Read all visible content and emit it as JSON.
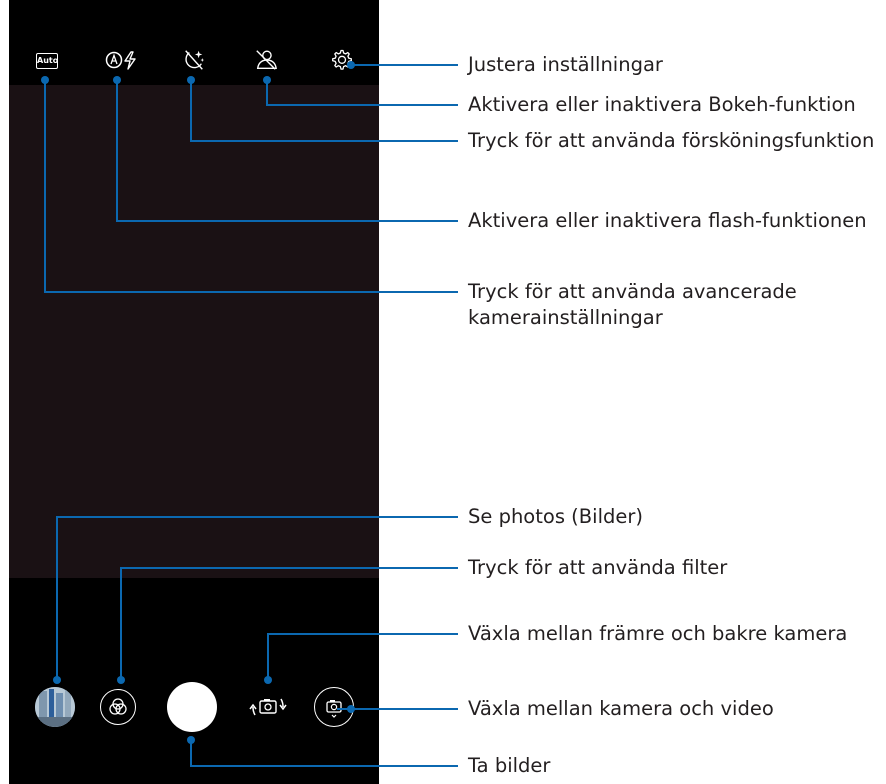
{
  "top_bar": {
    "auto_badge": "Auto",
    "icons": [
      "auto-mode-icon",
      "flash-auto-icon",
      "beautify-icon",
      "bokeh-off-icon",
      "settings-gear-icon"
    ]
  },
  "bottom_bar": {
    "icons": [
      "gallery-thumbnail",
      "filter-icon",
      "shutter-button",
      "switch-camera-icon",
      "camera-video-toggle-icon"
    ]
  },
  "callouts": {
    "settings": "Justera inställningar",
    "bokeh": "Aktivera eller inaktivera Bokeh-funktion",
    "beautify": "Tryck för att använda försköningsfunktion",
    "flash": "Aktivera eller inaktivera flash-funktionen",
    "advanced": "Tryck för att använda avancerade kamerainställningar",
    "gallery": "Se photos (Bilder)",
    "filter": "Tryck för att använda filter",
    "switch_camera": "Växla mellan främre och bakre kamera",
    "camera_video": "Växla mellan kamera och video",
    "take_photo": "Ta bilder"
  },
  "colors": {
    "callout_line": "#0b68b0",
    "phone_bg": "#000000",
    "viewfinder_bg": "#1a1114",
    "label_text": "#231f20"
  }
}
